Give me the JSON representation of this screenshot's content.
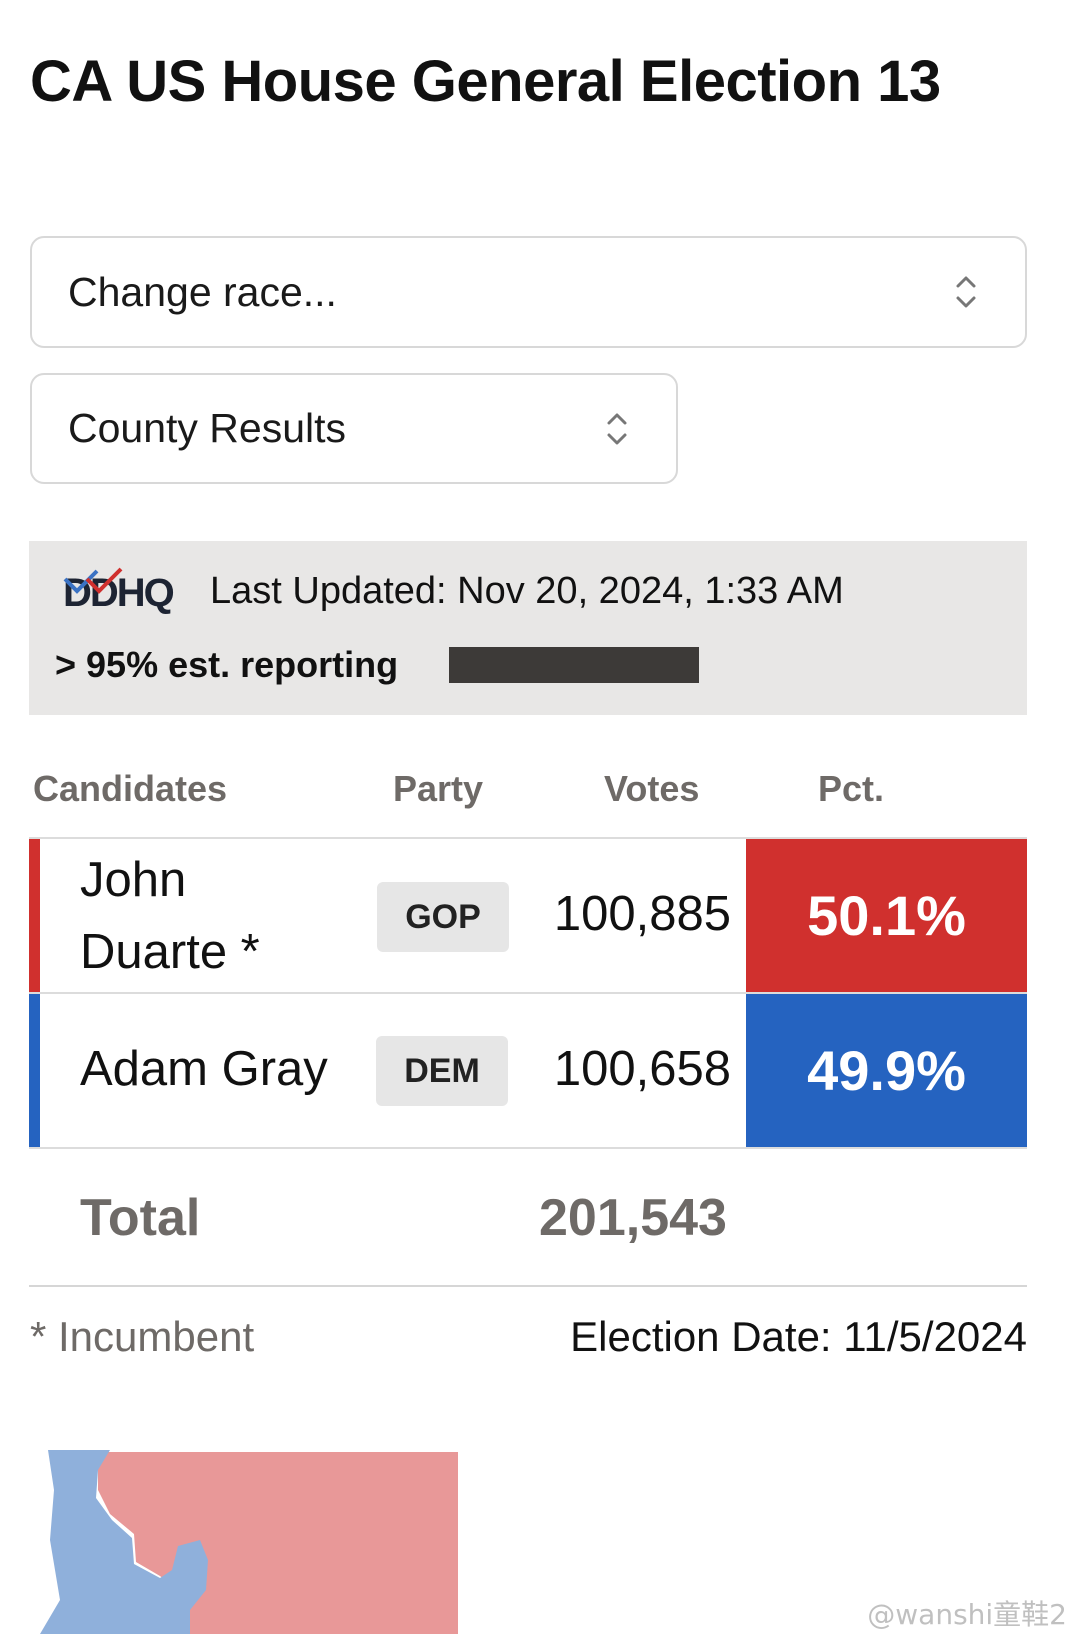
{
  "page": {
    "title": "CA US House General Election 13"
  },
  "selectors": {
    "race": {
      "value": "Change race..."
    },
    "view": {
      "value": "County Results"
    }
  },
  "info": {
    "source_logo": "DDHQ",
    "last_updated": "Last Updated: Nov 20, 2024, 1:33 AM",
    "reporting": "> 95% est. reporting",
    "reporting_fraction": 0.95
  },
  "table": {
    "headers": {
      "candidates": "Candidates",
      "party": "Party",
      "votes": "Votes",
      "pct": "Pct."
    },
    "rows": [
      {
        "name_line1": "John",
        "name_line2": "Duarte *",
        "party": "GOP",
        "votes": "100,885",
        "pct": "50.1%",
        "color": "#d0302e"
      },
      {
        "name": "Adam Gray",
        "party": "DEM",
        "votes": "100,658",
        "pct": "49.9%",
        "color": "#2563c0"
      }
    ],
    "total_label": "Total",
    "total_votes": "201,543"
  },
  "footer": {
    "incumbent_note": "* Incumbent",
    "election_date": "Election Date: 11/5/2024"
  },
  "map": {
    "colors": {
      "gop": "#e89898",
      "dem": "#8fb0db"
    }
  },
  "watermark": "@wanshi童鞋2"
}
